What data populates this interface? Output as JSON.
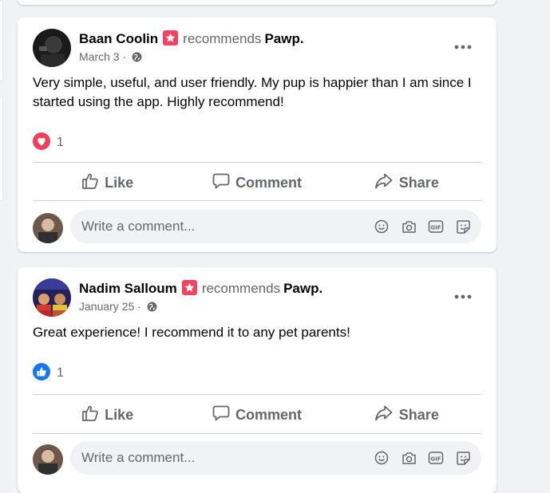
{
  "posts": [
    {
      "author": "Baan Coolin",
      "recommends_text": "recommends",
      "page_name": "Pawp.",
      "date": "March 3 ·",
      "text": "Very simple, useful, and user friendly. My pup is happier than I am since I started using the app. Highly recommend!",
      "reaction": {
        "type": "love",
        "count": "1"
      },
      "actions": {
        "like": "Like",
        "comment": "Comment",
        "share": "Share"
      },
      "comment_placeholder": "Write a comment..."
    },
    {
      "author": "Nadim Salloum",
      "recommends_text": "recommends",
      "page_name": "Pawp.",
      "date": "January 25 ·",
      "text": "Great experience! I recommend it to any pet parents!",
      "reaction": {
        "type": "like",
        "count": "1"
      },
      "actions": {
        "like": "Like",
        "comment": "Comment",
        "share": "Share"
      },
      "comment_placeholder": "Write a comment..."
    }
  ],
  "colors": {
    "love": "#f33e58",
    "like_reaction": "#1877f2",
    "recommend_badge": "#f3425f",
    "secondary_text": "#65676b"
  }
}
